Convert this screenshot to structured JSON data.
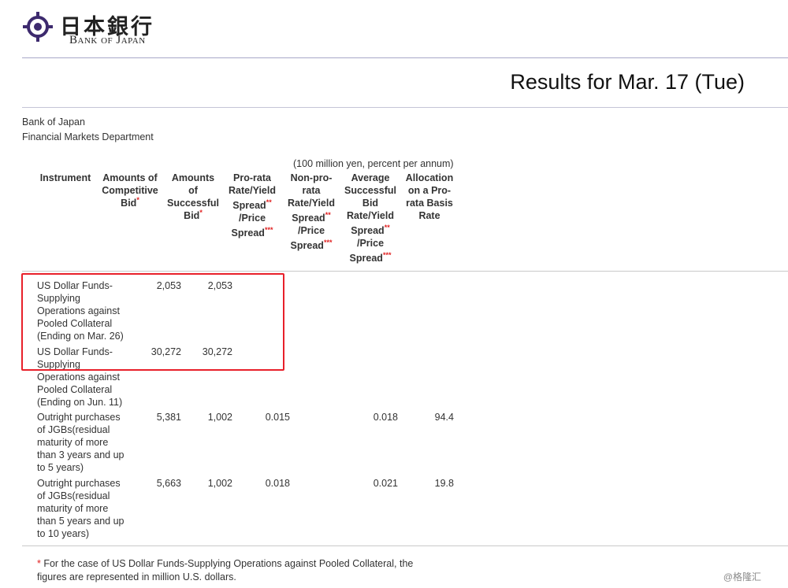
{
  "header": {
    "logo_jp": "日本銀行",
    "logo_en": "Bank of Japan",
    "title": "Results for Mar. 17 (Tue)"
  },
  "org": {
    "line1": "Bank of Japan",
    "line2": "Financial Markets Department"
  },
  "unit_note": "(100 million yen, percent per annum)",
  "columns": {
    "instrument": "Instrument",
    "competitive": [
      "Amounts of",
      "Competitive",
      "Bid"
    ],
    "successful": [
      "Amounts",
      "of",
      "Successful",
      "Bid"
    ],
    "prorata": [
      "Pro-rata",
      "Rate/Yield",
      "Spread",
      "/Price",
      "Spread"
    ],
    "nonprorata": [
      "Non-pro-",
      "rata",
      "Rate/Yield",
      "Spread",
      "/Price",
      "Spread"
    ],
    "average": [
      "Average",
      "Successful",
      "Bid",
      "Rate/Yield",
      "Spread",
      "/Price",
      "Spread"
    ],
    "allocation": [
      "Allocation",
      "on a Pro-",
      "rata Basis",
      "Rate"
    ],
    "ast1": "*",
    "ast2": "**",
    "ast3": "***"
  },
  "rows": [
    {
      "instrument": [
        "US Dollar Funds-",
        "Supplying",
        "Operations against",
        "Pooled Collateral",
        "(Ending on Mar. 26)"
      ],
      "competitive": "2,053",
      "successful": "2,053",
      "prorata": "",
      "average": "",
      "allocation": ""
    },
    {
      "instrument": [
        "US Dollar Funds-",
        "Supplying",
        "Operations against",
        "Pooled Collateral",
        "(Ending on Jun. 11)"
      ],
      "competitive": "30,272",
      "successful": "30,272",
      "prorata": "",
      "average": "",
      "allocation": ""
    },
    {
      "instrument": [
        "Outright purchases",
        "of JGBs(residual",
        "maturity of more",
        "than 3 years and up",
        "to 5 years)"
      ],
      "competitive": "5,381",
      "successful": "1,002",
      "prorata": "0.015",
      "average": "0.018",
      "allocation": "94.4"
    },
    {
      "instrument": [
        "Outright purchases",
        "of JGBs(residual",
        "maturity of more",
        "than 5 years and up",
        "to 10 years)"
      ],
      "competitive": "5,663",
      "successful": "1,002",
      "prorata": "0.018",
      "average": "0.021",
      "allocation": "19.8"
    }
  ],
  "footnote": {
    "ast": "*",
    "line1": " For the case of US Dollar Funds-Supplying Operations against Pooled Collateral, the",
    "line2": "figures are represented in million U.S. dollars."
  },
  "watermark": "@格隆汇",
  "colors": {
    "highlight": "#e8202a",
    "logo": "#3d2a6e",
    "asterisk": "#e02020"
  }
}
